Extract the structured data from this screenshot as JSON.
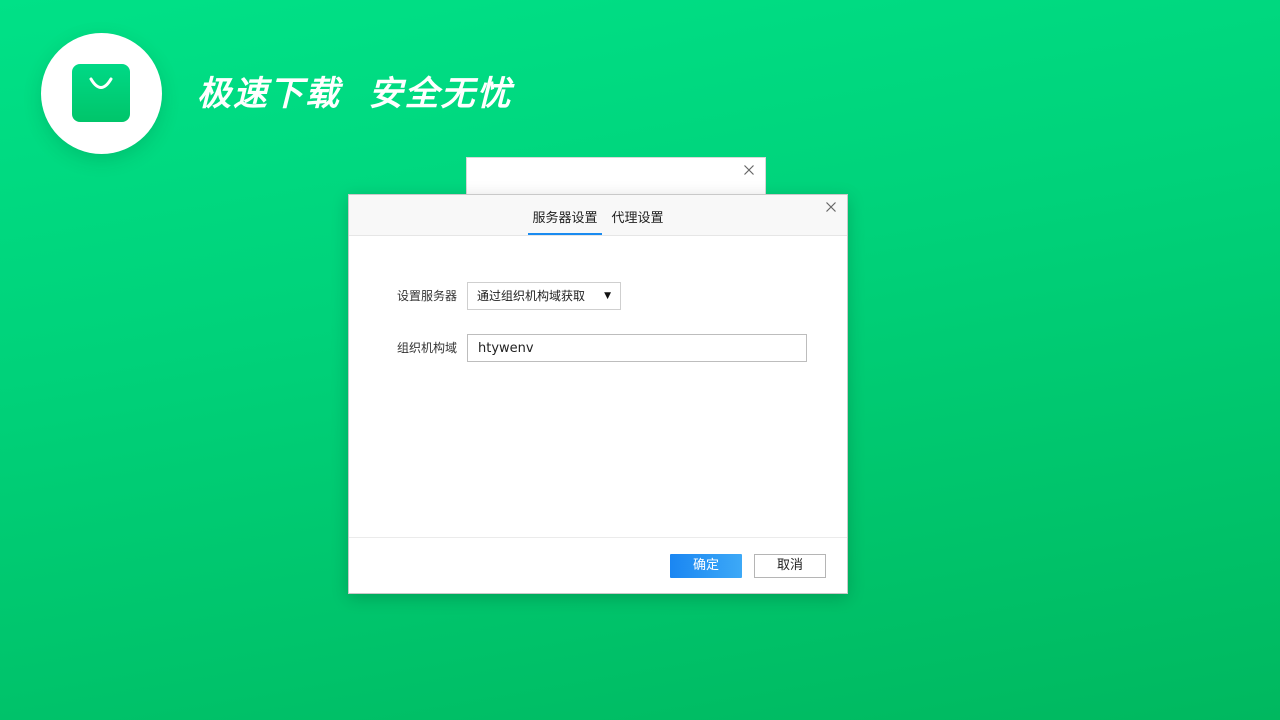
{
  "brand": {
    "slogan": "极速下载  安全无忧",
    "logo_icon": "shopping-bag-icon",
    "accent_color": "#00d27a"
  },
  "background_dialog": {
    "close_icon": "close-icon"
  },
  "dialog": {
    "tabs": [
      {
        "label": "服务器设置",
        "active": true
      },
      {
        "label": "代理设置",
        "active": false
      }
    ],
    "close_icon": "close-icon",
    "server_setting": {
      "label": "设置服务器",
      "selected": "通过组织机构域获取"
    },
    "org_domain": {
      "label": "组织机构域",
      "value": "htywenv"
    },
    "buttons": {
      "ok": "确定",
      "cancel": "取消"
    },
    "primary_color": "#1a8bf0"
  }
}
